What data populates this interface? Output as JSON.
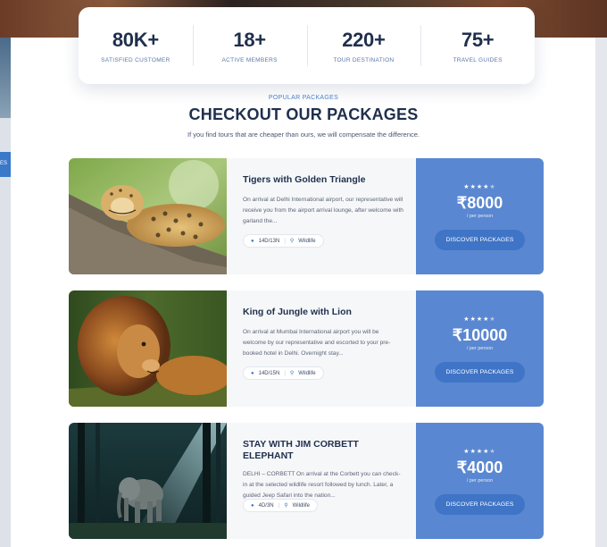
{
  "stats": [
    {
      "value": "80K+",
      "label": "SATISFIED CUSTOMER"
    },
    {
      "value": "18+",
      "label": "ACTIVE MEMBERS"
    },
    {
      "value": "220+",
      "label": "TOUR DESTINATION"
    },
    {
      "value": "75+",
      "label": "TRAVEL GUIDES"
    }
  ],
  "section": {
    "eyebrow": "POPULAR PACKAGES",
    "title": "CHECKOUT OUR PACKAGES",
    "subtitle": "If you find tours that are cheaper than ours, we will compensate the difference."
  },
  "sidebar_badge": "ES",
  "packages": [
    {
      "name": "Tigers with Golden Triangle",
      "desc": "On arrival at Delhi International airport, our representative will receive you from the airport arrival lounge, after welcome with garland the...",
      "duration": "14D/13N",
      "category": "Wildlife",
      "stars": "★★★★",
      "star_dim": "★",
      "price": "₹8000",
      "per": "/ per person",
      "button": "DISCOVER PACKAGES",
      "image": "leopard-on-tree"
    },
    {
      "name": "King of Jungle with Lion",
      "desc": "On arrival at Mumbai International airport you will be welcome by our representative and escorted to your pre-booked hotel in Delhi. Overnight stay...",
      "duration": "14D/15N",
      "category": "Wildlife",
      "stars": "★★★★",
      "star_dim": "★",
      "price": "₹10000",
      "per": "/ per person",
      "button": "DISCOVER PACKAGES",
      "image": "lion"
    },
    {
      "name": "STAY WITH JIM CORBETT ELEPHANT",
      "desc": "DELHI – CORBETT On arrival at the Corbett you can check-in at the selected wildlife resort followed by lunch. Later, a guided Jeep Safari into the nation...",
      "duration": "4D/3N",
      "category": "Wildlife",
      "stars": "★★★★",
      "star_dim": "★",
      "price": "₹4000",
      "per": "/ per person",
      "button": "DISCOVER PACKAGES",
      "image": "elephant-in-forest"
    }
  ]
}
